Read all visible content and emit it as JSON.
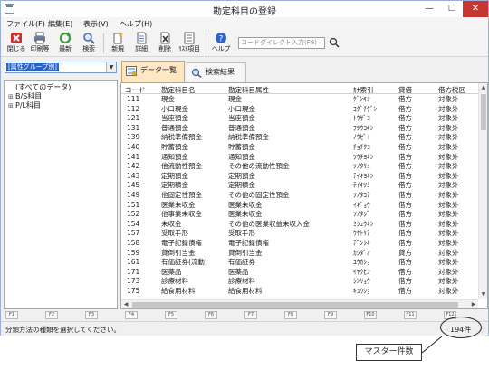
{
  "window": {
    "title": "勘定科目の登録",
    "controls": {
      "minimize": "—",
      "maximize": "□",
      "close": "✕"
    }
  },
  "menu": [
    "ファイル(F)",
    "編集(E)",
    "表示(V)",
    "ヘルプ(H)"
  ],
  "toolbar": {
    "buttons": [
      {
        "label": "閉じる",
        "icon": "close-x-icon",
        "color": "#d12f2f"
      },
      {
        "label": "印刷等",
        "icon": "printer-icon",
        "color": "#4d6fa8"
      },
      {
        "label": "最新",
        "icon": "refresh-icon",
        "color": "#3a9a3a"
      },
      {
        "label": "検索",
        "icon": "magnifier-icon",
        "color": "#4b6fa3"
      },
      {
        "label": "新規",
        "icon": "new-document-icon",
        "color": "#e5a82a"
      },
      {
        "label": "詳細",
        "icon": "detail-document-icon",
        "color": "#6a8bb8"
      },
      {
        "label": "削除",
        "icon": "delete-x-icon",
        "color": "#444444"
      },
      {
        "label": "ﾘｽﾄ項目",
        "icon": "list-items-icon",
        "color": "#7a7a7a"
      },
      {
        "label": "ヘルプ",
        "icon": "help-icon",
        "color": "#2f64c0"
      }
    ],
    "code_input_placeholder": "コードダイレクト入力(F8)"
  },
  "left": {
    "group_select": "[属性グループ別]",
    "tree": [
      {
        "prefix": "",
        "label": "(すべてのデータ)"
      },
      {
        "prefix": "⊞",
        "label": "B/S科目"
      },
      {
        "prefix": "⊞",
        "label": "P/L科目"
      }
    ]
  },
  "tabs": [
    {
      "label": "データ一覧",
      "active": true
    },
    {
      "label": "検索結果",
      "active": false
    }
  ],
  "grid": {
    "headers": [
      "コード",
      "勘定科目名",
      "勘定科目属性",
      "ｶﾅ索引",
      "貸借",
      "借方税区"
    ],
    "rows": [
      [
        "111",
        "現金",
        "現金",
        "ｹﾞﾝｷﾝ",
        "借方",
        "対象外"
      ],
      [
        "112",
        "小口現金",
        "小口現金",
        "ｺｸﾞﾁｹﾞﾝ",
        "借方",
        "対象外"
      ],
      [
        "121",
        "当座預金",
        "当座預金",
        "ﾄｳｻﾞﾖ",
        "借方",
        "対象外"
      ],
      [
        "131",
        "普通預金",
        "普通預金",
        "ﾌﾂｳﾖｷﾝ",
        "借方",
        "対象外"
      ],
      [
        "139",
        "納税準備預金",
        "納税準備預金",
        "ﾉｳｾﾞｲ",
        "借方",
        "対象外"
      ],
      [
        "140",
        "貯蓄預金",
        "貯蓄預金",
        "ﾁｮﾁｸﾖ",
        "借方",
        "対象外"
      ],
      [
        "141",
        "通知預金",
        "通知預金",
        "ﾂｳﾁﾖｷﾝ",
        "借方",
        "対象外"
      ],
      [
        "142",
        "他流動性預金",
        "その他の流動性預金",
        "ｿﾉﾀﾘｭ",
        "借方",
        "対象外"
      ],
      [
        "143",
        "定期預金",
        "定期預金",
        "ﾃｲｷﾖｷﾝ",
        "借方",
        "対象外"
      ],
      [
        "145",
        "定期積金",
        "定期積金",
        "ﾃｲｷﾂﾐ",
        "借方",
        "対象外"
      ],
      [
        "149",
        "他固定性預金",
        "その他の固定性預金",
        "ｿﾉﾀｺﾃ",
        "借方",
        "対象外"
      ],
      [
        "151",
        "医業未収金",
        "医業未収金",
        "ｲｷﾞｮｳ",
        "借方",
        "対象外"
      ],
      [
        "152",
        "他事業未収金",
        "医業未収金",
        "ｿﾉﾀｼﾞ",
        "借方",
        "対象外"
      ],
      [
        "154",
        "未収金",
        "その他の医業収益未収入金",
        "ﾐｼｭｳｷﾝ",
        "借方",
        "対象外"
      ],
      [
        "157",
        "受取手形",
        "受取手形",
        "ｳｹﾄﾘﾃ",
        "借方",
        "対象外"
      ],
      [
        "158",
        "電子記録債権",
        "電子記録債権",
        "ﾃﾞﾝｼｷ",
        "借方",
        "対象外"
      ],
      [
        "159",
        "貸倒引当金",
        "貸倒引当金",
        "ｶｼﾀﾞｵ",
        "貸方",
        "対象外"
      ],
      [
        "161",
        "有価証券(流動)",
        "有価証券",
        "ﾕｳｶｼｮ",
        "借方",
        "対象外"
      ],
      [
        "171",
        "医薬品",
        "医薬品",
        "ｲﾔｸﾋﾝ",
        "借方",
        "対象外"
      ],
      [
        "173",
        "診療材料",
        "診療材料",
        "ｼﾝﾘｮｳ",
        "借方",
        "対象外"
      ],
      [
        "175",
        "給食用材料",
        "給食用材料",
        "ｷｭｳｼｮ",
        "借方",
        "対象外"
      ]
    ]
  },
  "fkeys": [
    "F1",
    "F2",
    "F3",
    "F4",
    "F5",
    "F6",
    "F7",
    "F8",
    "F9",
    "F10",
    "F11",
    "F12"
  ],
  "status": {
    "message": "分類方法の種類を選択してください。",
    "count": "194件"
  },
  "callout": {
    "label": "マスター件数"
  }
}
